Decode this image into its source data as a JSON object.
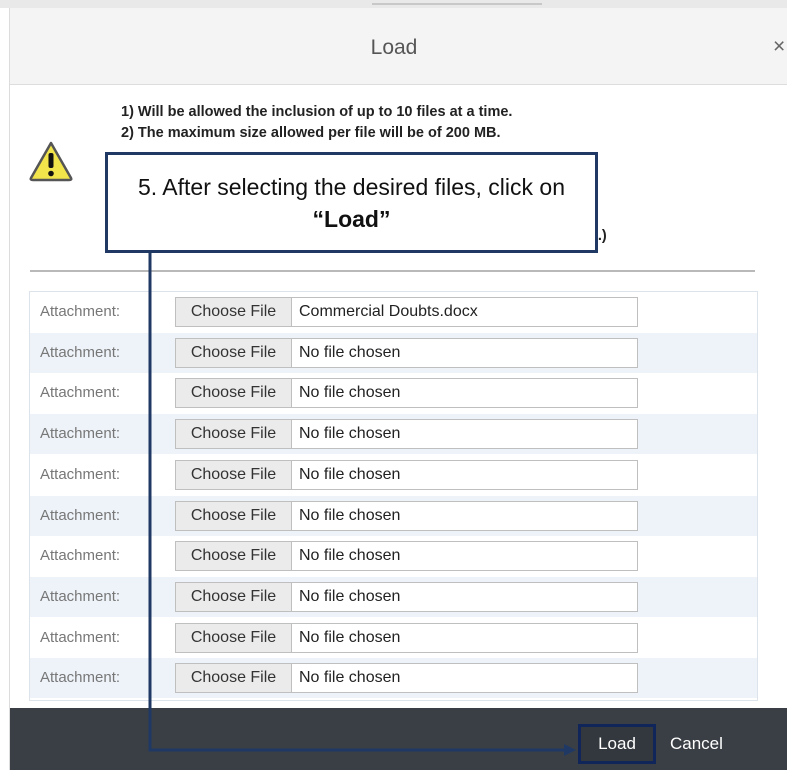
{
  "dialog": {
    "title": "Load",
    "close_symbol": "×"
  },
  "warning": {
    "icon": "warning-triangle-icon",
    "lines": [
      "1) Will be allowed the inclusion of up to 10 files at a time.",
      "2) The maximum size allowed per file will be of 200 MB."
    ],
    "partial_line_tail": "tc.)"
  },
  "callout": {
    "text_before": "5. After selecting the desired files, click on ",
    "text_bold": "“Load”",
    "border_color": "#1f3864"
  },
  "attachments": {
    "label": "Attachment:",
    "choose_label": "Choose File",
    "rows": [
      {
        "file": "Commercial Doubts.docx"
      },
      {
        "file": "No file chosen"
      },
      {
        "file": "No file chosen"
      },
      {
        "file": "No file chosen"
      },
      {
        "file": "No file chosen"
      },
      {
        "file": "No file chosen"
      },
      {
        "file": "No file chosen"
      },
      {
        "file": "No file chosen"
      },
      {
        "file": "No file chosen"
      },
      {
        "file": "No file chosen"
      }
    ]
  },
  "footer": {
    "load_label": "Load",
    "cancel_label": "Cancel",
    "background": "#3a3f45"
  }
}
